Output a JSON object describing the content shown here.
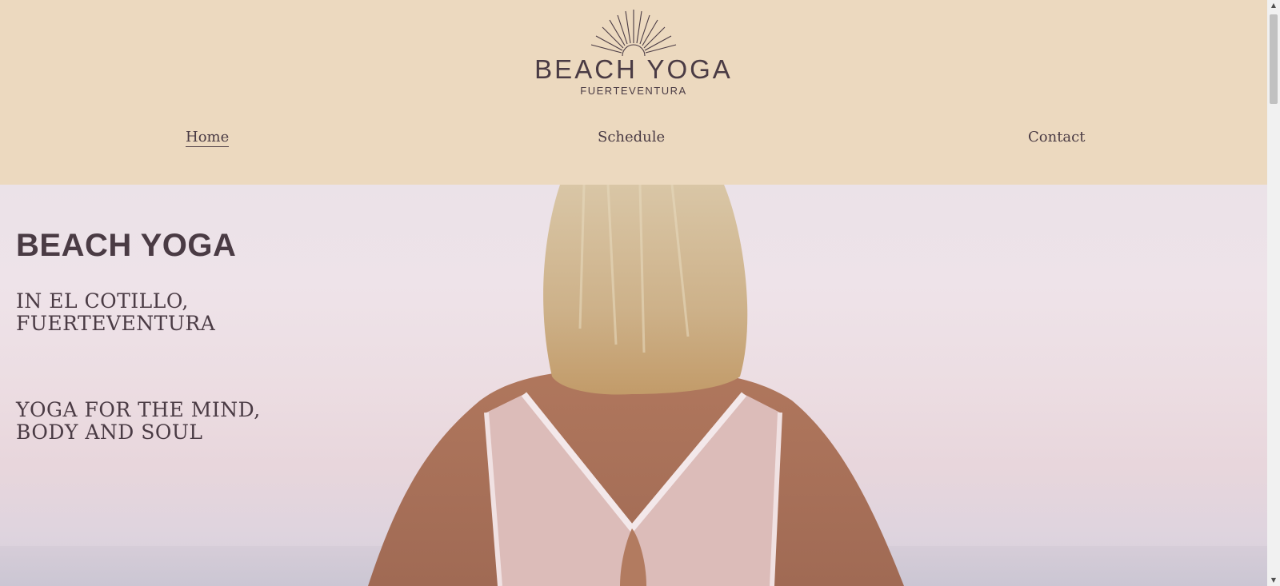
{
  "logo": {
    "icon": "sunrise-icon",
    "title": "BEACH YOGA",
    "subtitle": "FUERTEVENTURA"
  },
  "nav": {
    "items": [
      {
        "label": "Home",
        "active": true
      },
      {
        "label": "Schedule",
        "active": false
      },
      {
        "label": "Contact",
        "active": false
      }
    ]
  },
  "hero": {
    "heading": "BEACH YOGA",
    "location": "IN EL COTILLO, FUERTEVENTURA",
    "tagline": "YOGA FOR THE MIND, BODY AND SOUL",
    "image": "woman-in-reverse-prayer-pose-by-sea"
  },
  "colors": {
    "header_bg": "#ecd9bf",
    "text": "#4a3b44"
  },
  "scrollbar": {
    "up_icon": "arrow-up-icon",
    "down_icon": "arrow-down-icon"
  }
}
